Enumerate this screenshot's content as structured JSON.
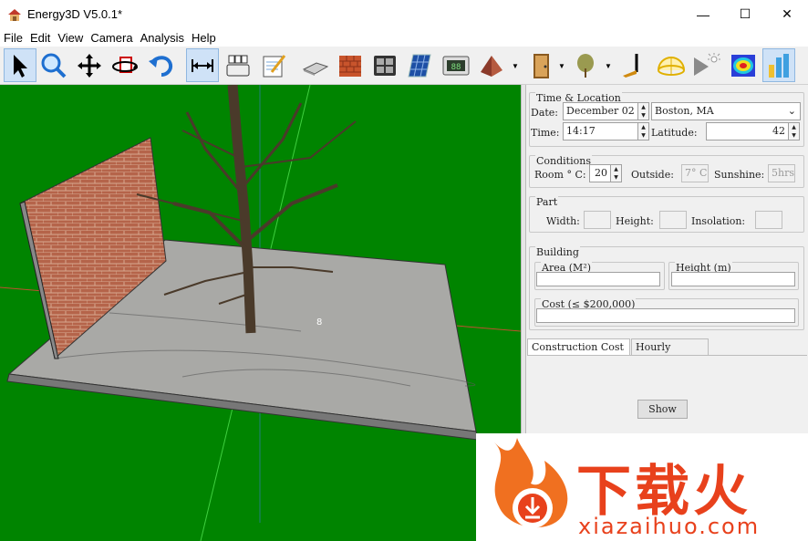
{
  "window": {
    "title": "Energy3D V5.0.1*",
    "controls": [
      "—",
      "☐",
      "✕"
    ]
  },
  "menu": [
    "File",
    "Edit",
    "View",
    "Camera",
    "Analysis",
    "Help"
  ],
  "viewport": {
    "marker": "8"
  },
  "panel": {
    "time_location": {
      "title": "Time & Location",
      "date_label": "Date:",
      "date_value": "December 02",
      "city_value": "Boston, MA",
      "time_label": "Time:",
      "time_value": "14:17",
      "latitude_label": "Latitude:",
      "latitude_value": "42"
    },
    "conditions": {
      "title": "Conditions",
      "room_label": "Room ° C:",
      "room_value": "20",
      "outside_label": "Outside:",
      "outside_value": "7° C",
      "sunshine_label": "Sunshine:",
      "sunshine_value": "5hrs"
    },
    "part": {
      "title": "Part",
      "width_label": "Width:",
      "height_label": "Height:",
      "insolation_label": "Insolation:"
    },
    "building": {
      "title": "Building",
      "area_label": "Area (M²)",
      "height_label": "Height (m)",
      "cost_label": "Cost (≤ $200,000)"
    },
    "tabs": [
      "Construction Cost",
      "Hourly Energy"
    ],
    "show_button": "Show"
  },
  "watermark": {
    "brand": "下载火",
    "url": "xiazaihuo.com",
    "color": "#e8411c"
  }
}
